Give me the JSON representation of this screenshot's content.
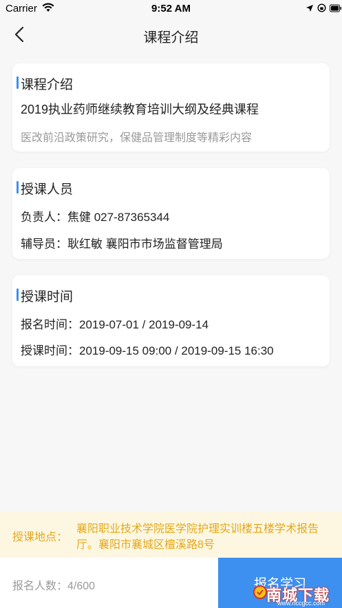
{
  "status_bar": {
    "carrier": "Carrier",
    "time": "9:52 AM",
    "icons": [
      "wifi-icon",
      "location-arrow-icon",
      "rotation-lock-icon",
      "battery-icon"
    ]
  },
  "nav": {
    "title": "课程介绍",
    "back_icon": "chevron-left-icon"
  },
  "intro_card": {
    "title": "课程介绍",
    "course_name": "2019执业药师继续教育培训大纲及经典课程",
    "description": "医改前沿政策研究，保健品管理制度等精彩内容"
  },
  "staff_card": {
    "title": "授课人员",
    "lead": "负责人：焦健  027-87365344",
    "tutor": "辅导员：耿红敏  襄阳市市场监督管理局"
  },
  "time_card": {
    "title": "授课时间",
    "signup_time": "报名时间：2019-07-01 / 2019-09-14",
    "class_time": "授课时间：2019-09-15 09:00 / 2019-09-15 16:30"
  },
  "location": {
    "label": "授课地点：",
    "value": "襄阳职业技术学院医学院护理实训楼五楼学术报告厅。襄阳市襄城区檀溪路8号"
  },
  "bottom": {
    "count": "报名人数：4/600",
    "signup_button": "报名学习"
  },
  "watermark": {
    "text": "南城下载",
    "url": "www.nccgcc.com"
  },
  "colors": {
    "accent": "#3d8ff0",
    "location_text": "#e3a81c",
    "location_bg": "#fdf7e2"
  }
}
